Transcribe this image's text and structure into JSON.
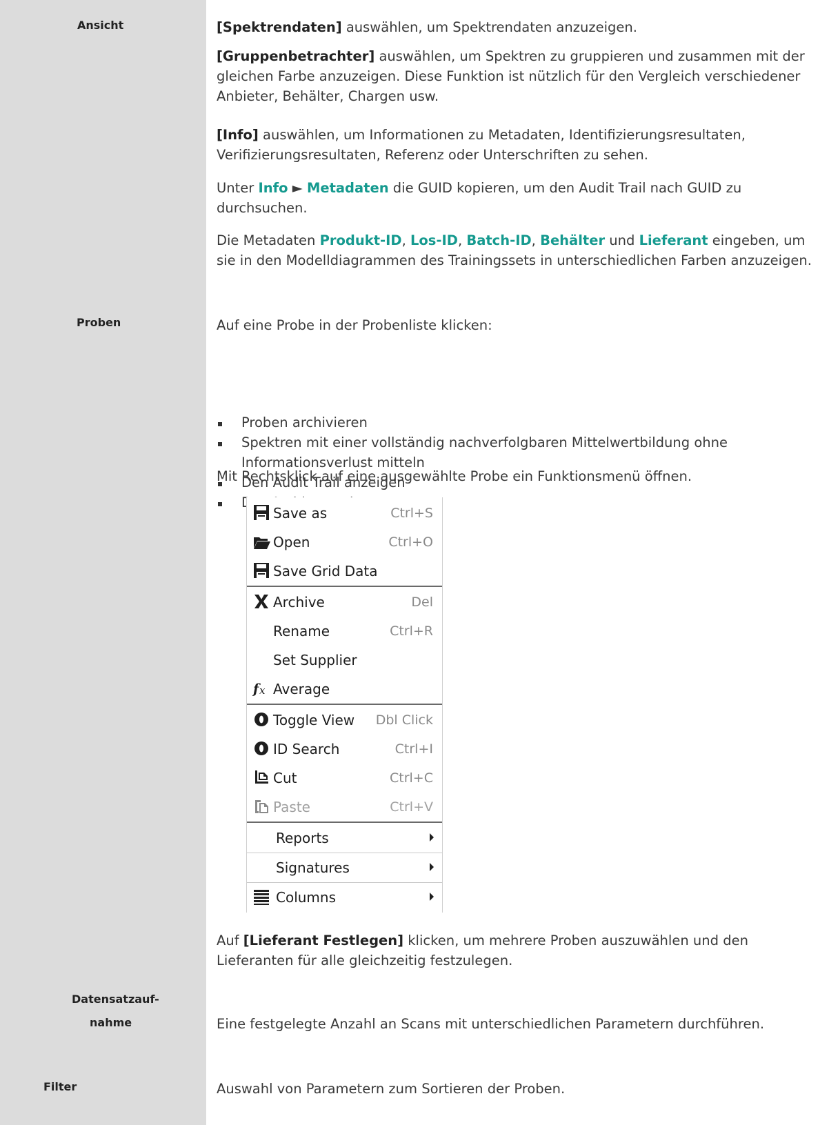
{
  "terms": {
    "ansicht": "Ansicht",
    "proben": "Proben",
    "datensatz_1": "Datensatzauf-",
    "datensatz_2": "nahme",
    "filter": "Filter"
  },
  "ansicht": {
    "p1_bold": "[Spektrendaten]",
    "p1_rest": " auswählen, um Spektrendaten anzuzeigen.",
    "p2_bold": "[Gruppenbetrachter]",
    "p2_rest": " auswählen, um Spektren zu gruppieren und zusammen mit der gleichen Farbe anzuzeigen. Diese Funktion ist nützlich für den Vergleich verschiedener Anbieter, Behälter, Chargen usw.",
    "p3_bold": "[Info]",
    "p3_rest": " auswählen, um Informationen zu Metadaten, Identifizierungsresultaten, Verifizierungsresultaten, Referenz oder Unterschriften zu sehen.",
    "p4_pre": "Unter ",
    "p4_info": "Info",
    "p4_arrow": " ► ",
    "p4_meta": "Metadaten",
    "p4_rest": " die GUID kopieren, um den Audit Trail nach GUID zu durchsuchen.",
    "p5_pre": "Die Metadaten ",
    "p5_k1": "Produkt-ID",
    "p5_c1": ", ",
    "p5_k2": "Los-ID",
    "p5_c2": ", ",
    "p5_k3": "Batch-ID",
    "p5_c3": ", ",
    "p5_k4": "Behälter",
    "p5_and": " und ",
    "p5_k5": "Lieferant",
    "p5_rest": " einge­ben, um sie in den Modelldiagrammen des Trainingssets in unterschiedlichen Farben anzuzeigen."
  },
  "proben": {
    "intro": "Auf eine Probe in der Probenliste klicken:",
    "bullets": [
      "Proben archivieren",
      "Spektren mit einer vollständig nachverfolgbaren Mittelwertbildung ohne Informationsverlust mitteln",
      "Den Audit Trail anzeigen",
      "Das Archiv anzeigen"
    ],
    "rightclick": "Mit Rechtsklick auf eine ausgewählte Probe ein Funktionsmenü öffnen.",
    "after_pre": "Auf ",
    "after_bold": "[Lieferant Festlegen]",
    "after_rest": " klicken, um mehrere Proben auszuwählen und den Lieferanten für alle gleichzeitig festzulegen."
  },
  "menu": {
    "items": [
      {
        "label": "Save as",
        "shortcut": "Ctrl+S",
        "icon": "save-icon"
      },
      {
        "label": "Open",
        "shortcut": "Ctrl+O",
        "icon": "folder-open-icon"
      },
      {
        "label": "Save Grid Data",
        "shortcut": "",
        "icon": "save-icon"
      },
      {
        "label": "Archive",
        "shortcut": "Del",
        "icon": "x-icon"
      },
      {
        "label": "Rename",
        "shortcut": "Ctrl+R",
        "icon": ""
      },
      {
        "label": "Set Supplier",
        "shortcut": "",
        "icon": ""
      },
      {
        "label": "Average",
        "shortcut": "",
        "icon": "function-icon"
      },
      {
        "label": "Toggle View",
        "shortcut": "Dbl Click",
        "icon": "toggle-view-icon"
      },
      {
        "label": "ID Search",
        "shortcut": "Ctrl+I",
        "icon": "id-search-icon"
      },
      {
        "label": "Cut",
        "shortcut": "Ctrl+C",
        "icon": "cut-icon"
      },
      {
        "label": "Paste",
        "shortcut": "Ctrl+V",
        "icon": "paste-icon",
        "disabled": true
      },
      {
        "label": "Reports",
        "submenu": true
      },
      {
        "label": "Signatures",
        "submenu": true
      },
      {
        "label": "Columns",
        "submenu": true,
        "icon": "columns-icon"
      }
    ]
  },
  "datensatz": {
    "text": "Eine festgelegte Anzahl an Scans mit unterschiedlichen Parametern durchführen."
  },
  "filter": {
    "text": "Auswahl von Parametern zum Sortieren der Proben."
  },
  "colors": {
    "sidebar": "#dcdcdc",
    "accent_teal": "#159a8f"
  }
}
